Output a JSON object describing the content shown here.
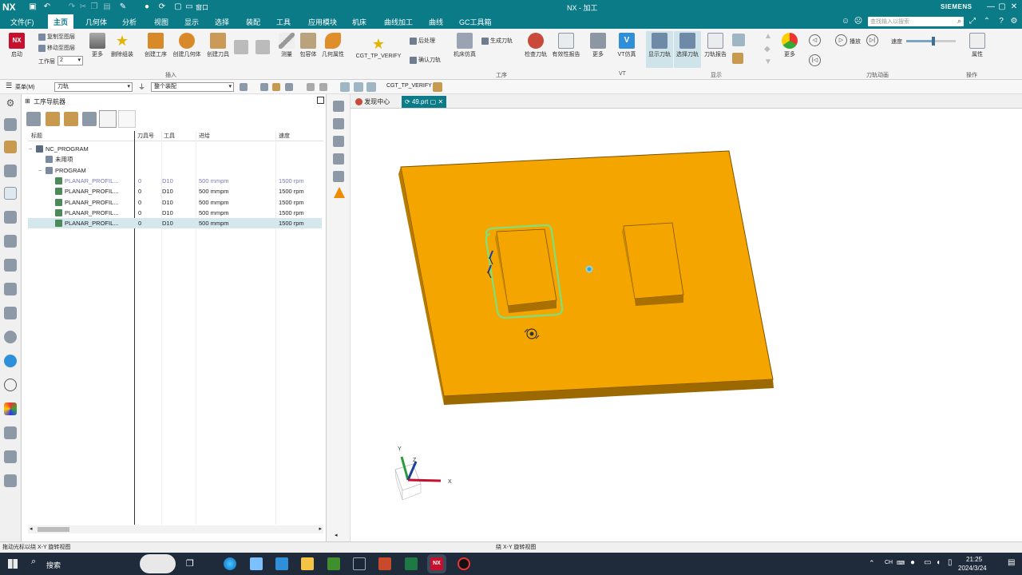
{
  "titlebar": {
    "logo": "NX",
    "window_menu": "窗口",
    "title": "NX - 加工",
    "brand": "SIEMENS"
  },
  "menubar": {
    "items": [
      "文件(F)",
      "主页",
      "几何体",
      "分析",
      "视图",
      "显示",
      "选择",
      "装配",
      "工具",
      "应用模块",
      "机床",
      "曲线加工",
      "曲线",
      "GC工具箱"
    ],
    "active": "主页",
    "search_placeholder": "查找输入以搜索"
  },
  "ribbon": {
    "start": "启动",
    "copy_layer": "复制至图层",
    "move_layer": "移动至图层",
    "work_layer_label": "工作层",
    "work_layer_value": "2",
    "more": "更多",
    "delete_group": "删除组装",
    "create_program": "创建工序",
    "create_geometry": "创建几何体",
    "create_tool": "创建刀具",
    "measure": "测量",
    "envelope": "包容体",
    "geometry_props": "几何属性",
    "insert_group": "插入",
    "cgt_verify": "CGT_TP_VERIFY",
    "postprocess": "后处理",
    "confirm_tool": "确认刀轨",
    "generate_path": "生成刀轨",
    "machine_sim": "机床仿真",
    "check_tool": "检查刀轨",
    "validity_report": "有效性报告",
    "more2": "更多",
    "operation_group": "工序",
    "vt_sim": "VT仿真",
    "vt_group": "VT",
    "show_path": "显示刀轨",
    "select_path": "选择刀轨",
    "path_report": "刀轨报告",
    "display_group": "显示",
    "more3": "更多",
    "play": "播放",
    "speed": "速度",
    "speed_level": 0.55,
    "path_anim_group": "刀轨动画",
    "properties": "属性",
    "actions_group": "操作"
  },
  "selbar": {
    "menu": "菜单(M)",
    "filter": "刀轨",
    "scope": "整个装配",
    "cgt": "CGT_TP_VERIFY"
  },
  "navigator": {
    "title": "工序导航器",
    "columns": [
      "标题",
      "刀具号",
      "工具",
      "进给",
      "速度"
    ],
    "rows": [
      {
        "name": "NC_PROGRAM",
        "tool_no": "",
        "tool": "",
        "feed": "",
        "speed": "",
        "indent": 1,
        "icon": "program-root"
      },
      {
        "name": "未用项",
        "tool_no": "",
        "tool": "",
        "feed": "",
        "speed": "",
        "indent": 2,
        "icon": "folder"
      },
      {
        "name": "PROGRAM",
        "tool_no": "",
        "tool": "",
        "feed": "",
        "speed": "",
        "indent": 2,
        "icon": "folder"
      },
      {
        "name": "PLANAR_PROFIL...",
        "tool_no": "0",
        "tool": "D10",
        "feed": "500 mmpm",
        "speed": "1500 rpm",
        "indent": 3,
        "icon": "operation",
        "state": "dim"
      },
      {
        "name": "PLANAR_PROFIL...",
        "tool_no": "0",
        "tool": "D10",
        "feed": "500 mmpm",
        "speed": "1500 rpm",
        "indent": 3,
        "icon": "operation"
      },
      {
        "name": "PLANAR_PROFIL...",
        "tool_no": "0",
        "tool": "D10",
        "feed": "500 mmpm",
        "speed": "1500 rpm",
        "indent": 3,
        "icon": "operation"
      },
      {
        "name": "PLANAR_PROFIL...",
        "tool_no": "0",
        "tool": "D10",
        "feed": "500 mmpm",
        "speed": "1500 rpm",
        "indent": 3,
        "icon": "operation"
      },
      {
        "name": "PLANAR_PROFIL...",
        "tool_no": "0",
        "tool": "D10",
        "feed": "500 mmpm",
        "speed": "1500 rpm",
        "indent": 3,
        "icon": "operation",
        "state": "selected"
      }
    ]
  },
  "tabs": {
    "discovery": "发现中心",
    "file": "49.prt"
  },
  "viewport": {
    "axis_x": "X",
    "axis_y": "Y",
    "axis_z": "Z",
    "part_color": "#f5a500",
    "toolpath_color": "#7de07d"
  },
  "status": {
    "left": "拖动光标以绕 X-Y 旋转视图",
    "center": "绕 X-Y 旋转视图"
  },
  "taskbar": {
    "search": "搜索",
    "lang": "CH",
    "time": "21:25",
    "date": "2024/3/24"
  }
}
